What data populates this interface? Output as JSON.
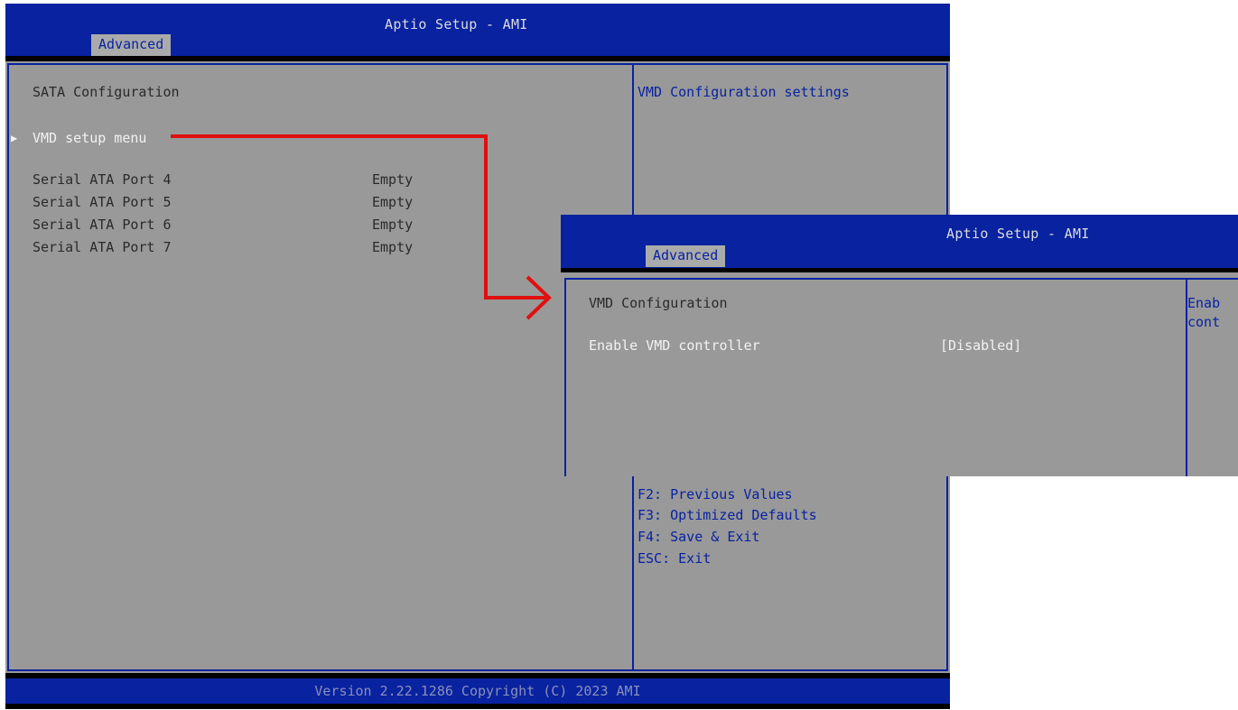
{
  "back_screen": {
    "title": "Aptio Setup - AMI",
    "tab": "Advanced",
    "section_title": "SATA Configuration",
    "submenu_marker": "▶",
    "submenu_label": "VMD setup menu",
    "ports": [
      {
        "label": "Serial ATA Port 4",
        "value": "Empty"
      },
      {
        "label": "Serial ATA Port 5",
        "value": "Empty"
      },
      {
        "label": "Serial ATA Port 6",
        "value": "Empty"
      },
      {
        "label": "Serial ATA Port 7",
        "value": "Empty"
      }
    ],
    "help_text": "VMD Configuration settings",
    "keys": [
      "F2: Previous Values",
      "F3: Optimized Defaults",
      "F4: Save & Exit",
      "ESC: Exit"
    ],
    "footer": "Version 2.22.1286 Copyright (C) 2023 AMI"
  },
  "front_screen": {
    "title": "Aptio Setup - AMI",
    "tab": "Advanced",
    "section_title": "VMD Configuration",
    "option_label": "Enable VMD controller",
    "option_value": "[Disabled]",
    "help_line1": "Enab",
    "help_line2": "cont"
  },
  "colors": {
    "bios_blue": "#0822a0",
    "panel_gray": "#999999",
    "arrow_red": "#e01010"
  }
}
